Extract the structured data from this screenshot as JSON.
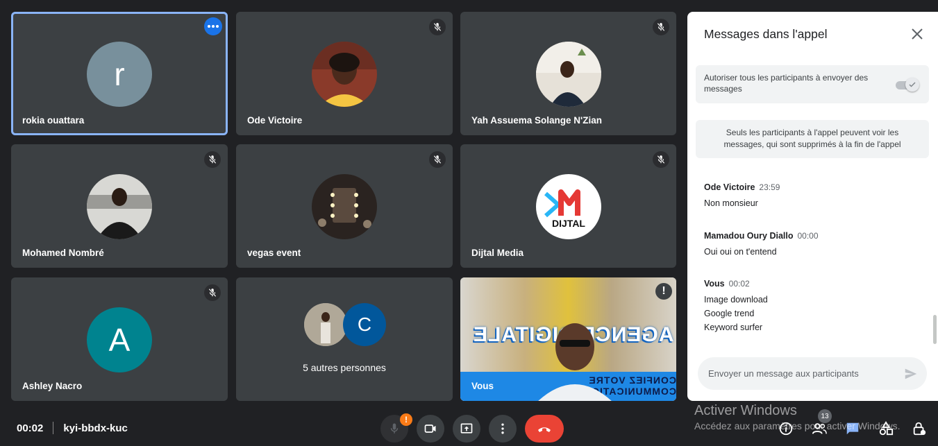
{
  "tiles": [
    {
      "name": "rokia ouattara",
      "avatar_letter": "r",
      "avatar_color": "#78909c"
    },
    {
      "name": "Ode Victoire"
    },
    {
      "name": "Yah Assuema Solange N'Zian"
    },
    {
      "name": "Mohamed Nombré"
    },
    {
      "name": "vegas event"
    },
    {
      "name": "Dijtal Media",
      "logo_text": "DIJTAL"
    },
    {
      "name": "Ashley Nacro",
      "avatar_letter": "A",
      "avatar_color": "#00838f"
    },
    {
      "others_label": "5 autres personnes",
      "avatar_letter": "C",
      "avatar_color": "#01579b"
    },
    {
      "name": "Vous",
      "banner_top": "AGENCE DIGITALE",
      "banner_bottom": "CONFIEZ VOTRE COMMUNICATION"
    }
  ],
  "panel": {
    "title": "Messages dans l'appel",
    "allow_text": "Autoriser tous les participants à envoyer des messages",
    "info_text": "Seuls les participants à l'appel peuvent voir les messages, qui sont supprimés à la fin de l'appel",
    "messages": [
      {
        "sender": "Ode Victoire",
        "time": "23:59",
        "lines": [
          "Non monsieur"
        ]
      },
      {
        "sender": "Mamadou Oury Diallo",
        "time": "00:00",
        "lines": [
          "Oui oui on t'entend"
        ]
      },
      {
        "sender": "Vous",
        "time": "00:02",
        "lines": [
          "Image download",
          "Google trend",
          "Keyword surfer"
        ]
      }
    ],
    "input_placeholder": "Envoyer un message aux participants"
  },
  "bottom": {
    "time": "00:02",
    "meeting_code": "kyi-bbdx-kuc",
    "mic_warning": "!",
    "participants_count": "13"
  },
  "watermark": {
    "line1": "Activer Windows",
    "line2": "Accédez aux paramètres pour activer Windows."
  },
  "colors": {
    "accent": "#1a73e8",
    "end_call": "#ea4335",
    "warning": "#fa7b17",
    "tile_bg": "#3c4043"
  }
}
